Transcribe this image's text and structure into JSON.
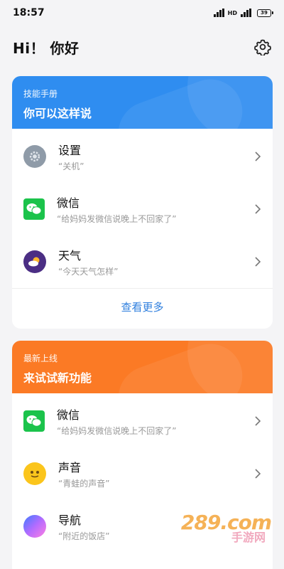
{
  "status_bar": {
    "time": "18:57",
    "battery": "39"
  },
  "header": {
    "greeting": "Hi！ 你好"
  },
  "skills_card": {
    "subtitle": "技能手册",
    "title": "你可以这样说",
    "items": [
      {
        "name": "设置",
        "example": "“关机”",
        "icon": "settings-icon"
      },
      {
        "name": "微信",
        "example": "“给妈妈发微信说晚上不回家了”",
        "icon": "wechat-icon"
      },
      {
        "name": "天气",
        "example": "“今天天气怎样”",
        "icon": "weather-icon"
      }
    ],
    "more": "查看更多"
  },
  "new_card": {
    "subtitle": "最新上线",
    "title": "来试试新功能",
    "items": [
      {
        "name": "微信",
        "example": "“给妈妈发微信说晚上不回家了”",
        "icon": "wechat-icon"
      },
      {
        "name": "声音",
        "example": "“青蛙的声音”",
        "icon": "frog-icon"
      },
      {
        "name": "导航",
        "example": "“附近的饭店”",
        "icon": "navigation-icon"
      }
    ]
  },
  "watermark": {
    "text": "289.com",
    "sub": "手游网"
  },
  "colors": {
    "blue_header": "#2f8df0",
    "orange_header": "#fb7a25",
    "link": "#2f7fde"
  }
}
